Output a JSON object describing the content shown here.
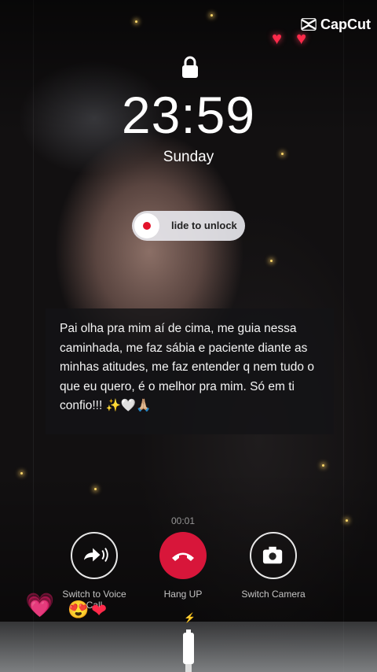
{
  "watermark": {
    "text": "CapCut",
    "icon": "capcut-logo-icon"
  },
  "lockscreen": {
    "lock_icon": "lock-icon",
    "time": "23:59",
    "day": "Sunday",
    "slider": {
      "label": "lide to unlock"
    }
  },
  "caption": {
    "text": "Pai olha pra mim aí de cima, me guia nessa caminhada, me faz sábia e paciente diante as minhas atitudes, me faz entender q nem tudo o que eu quero, é o melhor pra mim. Só em ti confio!!! ✨🤍🙏🏼"
  },
  "call": {
    "duration": "00:01",
    "buttons": [
      {
        "label": "Switch to Voice Call",
        "icon": "voice-call-icon"
      },
      {
        "label": "Hang UP",
        "icon": "hang-up-icon"
      },
      {
        "label": "Switch Camera",
        "icon": "camera-icon"
      }
    ]
  },
  "decor": {
    "hearts_top": [
      "♥",
      "♥"
    ],
    "bottom_emoji": [
      "💗",
      "😍",
      "❤"
    ],
    "charging_icon": "lightning-bolt-icon"
  },
  "colors": {
    "hangup": "#d8163a",
    "slider_dot": "#e3132a",
    "heart": "#ff2a4a"
  }
}
